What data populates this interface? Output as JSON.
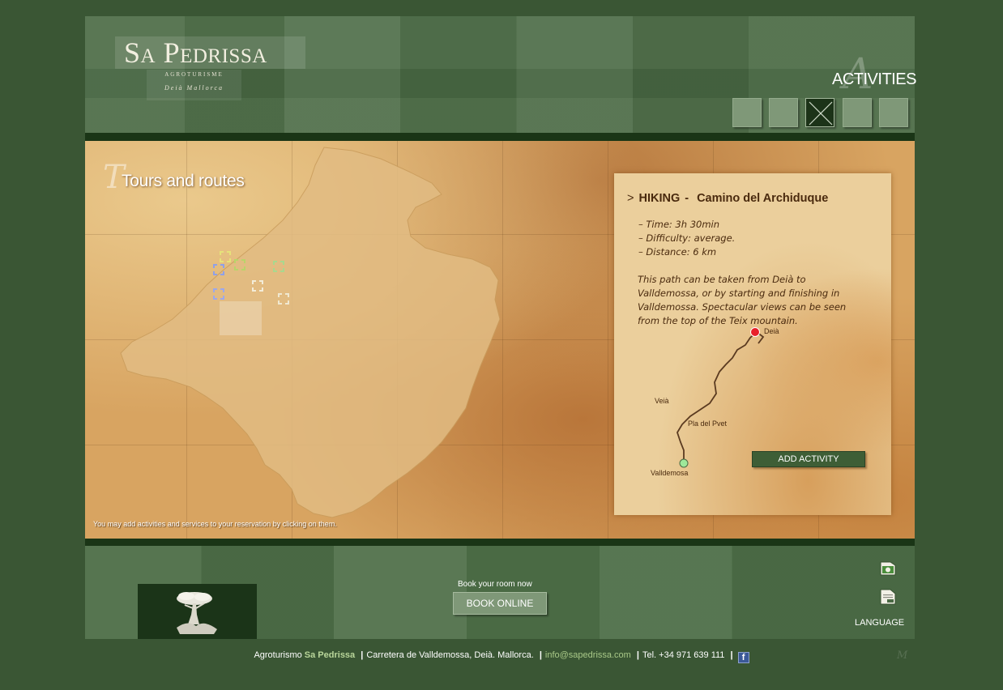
{
  "header": {
    "logo": {
      "title": "Sa Pedrissa",
      "subtitle": "AGROTURISME",
      "place": "Deià Mallorca"
    },
    "section_title": "ACTIVITIES",
    "section_deco": "A",
    "nav_buttons_count": 5,
    "active_nav_index": 2
  },
  "map": {
    "title": "Tours and routes",
    "title_deco": "T",
    "hint": "You may add activities and services to your reservation by clicking on them."
  },
  "card": {
    "arrow": ">",
    "category": "HIKING",
    "separator": "-",
    "name": "Camino del Archiduque",
    "time": "– Time: 3h 30min",
    "difficulty": "– Difficulty: average.",
    "distance": "– Distance: 6 km",
    "description": "This path can be taken from Deià to Valldemossa, or by starting and finishing in Valldemossa. Spectacular views can be seen from the top of the Teix mountain.",
    "route_labels": {
      "start": "Deià",
      "veia": "Veià",
      "pla": "Pla del Pvet",
      "end": "Valldemosa"
    },
    "add_button": "ADD ACTIVITY"
  },
  "footer": {
    "book_label": "Book your room now",
    "book_button": "BOOK ONLINE",
    "language_label": "LANGUAGE"
  },
  "contact": {
    "prefix": "Agroturismo",
    "brand": "Sa Pedrissa",
    "address": "Carretera de Valldemossa, Deià. Mallorca.",
    "email": "info@sapedrissa.com",
    "phone": "Tel. +34 971 639 111",
    "facebook_glyph": "f"
  },
  "colors": {
    "background": "#3a5634",
    "dark_bar": "#1a3516",
    "map_sand": "#d8a461",
    "button_green": "#3e5e36",
    "brand_green": "#b9d69a",
    "route_start": "#e8202a",
    "route_end": "#9ee89a"
  },
  "icons": [
    "close-icon",
    "tree-logo-icon",
    "catalan-language-icon",
    "german-language-icon",
    "facebook-icon"
  ]
}
